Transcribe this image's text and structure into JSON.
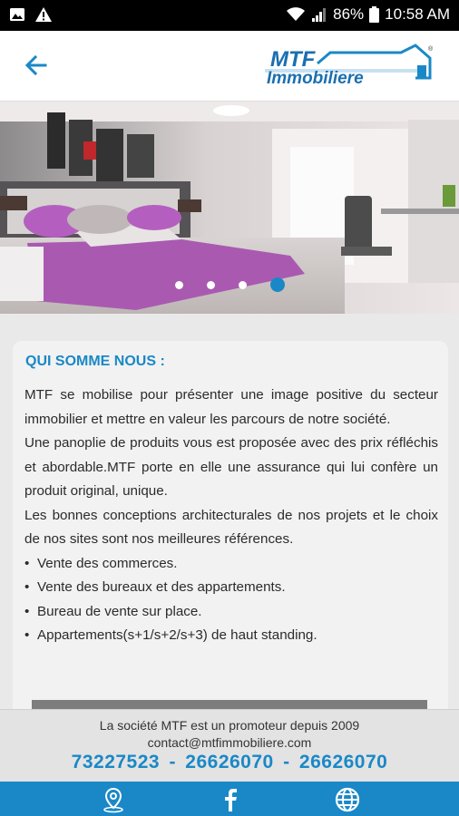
{
  "status": {
    "battery": "86%",
    "time": "10:58 AM"
  },
  "header": {
    "logo_top": "MTF",
    "logo_bottom": "Immobiliere",
    "logo_mark": "®"
  },
  "carousel": {
    "active_index": 3,
    "count": 4
  },
  "about": {
    "title": "QUI SOMME NOUS :",
    "p1": "MTF se mobilise pour présenter une image positive du secteur immobilier et mettre en valeur les parcours de notre société.",
    "p2": "Une panoplie de produits vous est proposée avec des prix réfléchis et abordable.MTF porte en elle une assurance qui lui confère un produit original, unique.",
    "p3": "Les bonnes conceptions architecturales de nos projets et le choix de nos sites sont nos meilleures références.",
    "bullets": [
      "Vente des commerces.",
      "Vente des bureaux et des appartements.",
      "Bureau de vente sur place.",
      "Appartements(s+1/s+2/s+3) de haut standing."
    ]
  },
  "footer": {
    "line1": "La société MTF est un promoteur depuis 2009",
    "line2": "contact@mtfimmobiliere.com",
    "phone1": "73227523",
    "phone2": "26626070",
    "phone3": "26626070",
    "sep": "-"
  },
  "tabs": [
    "location-pin-icon",
    "facebook-icon",
    "globe-icon"
  ],
  "colors": {
    "accent": "#1a88c7",
    "status_bar": "#000000"
  }
}
